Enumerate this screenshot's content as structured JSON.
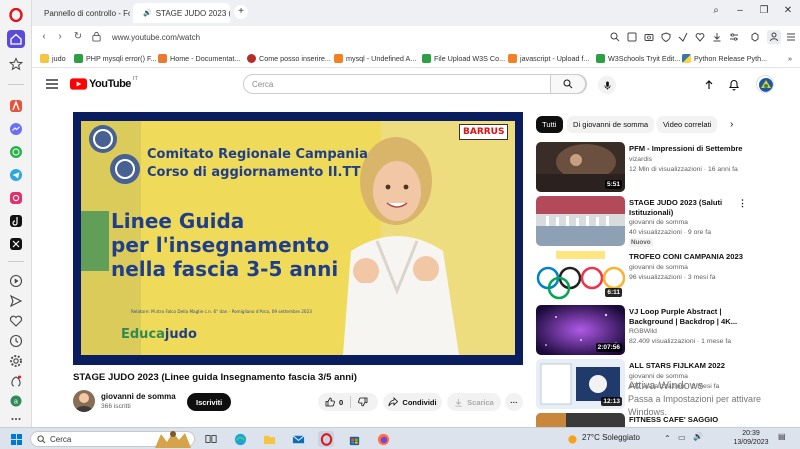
{
  "tabs": [
    {
      "label": "Pannello di controllo - Fo",
      "active": false
    },
    {
      "label": "STAGE JUDO 2023 (Li",
      "active": true
    }
  ],
  "address": {
    "url": "www.youtube.com/watch"
  },
  "bookmarks": [
    "judo",
    "PHP mysqli error() F...",
    "Home - Documentat...",
    "Come posso inserire...",
    "mysql - Undefined A...",
    "File Upload W3S Co...",
    "javascript - Upload f...",
    "W3Schools Tryit Edit...",
    "Python Release Pyth..."
  ],
  "youtube": {
    "logo": "YouTube",
    "logo_region": "IT",
    "search_placeholder": "Cerca"
  },
  "video_overlay": {
    "line1": "Comitato Regionale Campania",
    "line2": "Corso di aggiornamento II.TT",
    "line3": "Linee Guida",
    "line4": "per l'insegnamento",
    "line5": "nella fascia 3-5 anni",
    "badge": "BARRUS",
    "footer": "Relatore: M.stro Falco Della Maglie c.n. 6° dan - Pomigliano d'Arco, 09 settembre 2023",
    "brand_a": "Educa",
    "brand_b": "judo"
  },
  "video": {
    "title": "STAGE JUDO 2023 (Linee guida Insegnamento fascia 3/5 anni)",
    "channel": "giovanni de somma",
    "subscribers": "366 iscritti",
    "subscribe_label": "Iscriviti",
    "likes": "0",
    "share_label": "Condividi",
    "download_label": "Scarica",
    "more": "···"
  },
  "chips": [
    {
      "label": "Tutti",
      "active": true
    },
    {
      "label": "Di giovanni de somma",
      "active": false
    },
    {
      "label": "Video correlati",
      "active": false
    }
  ],
  "recommendations": [
    {
      "title": "PFM - Impressioni di Settembre",
      "channel": "vizardis",
      "meta": "12 Mln di visualizzazioni · 16 anni fa",
      "duration": "5:51",
      "badge": ""
    },
    {
      "title": "STAGE JUDO 2023 (Saluti Istituzionali)",
      "channel": "giovanni de somma",
      "meta": "40 visualizzazioni · 9 ore fa",
      "duration": "",
      "badge": "Nuovo"
    },
    {
      "title": "TROFEO CONI CAMPANIA 2023",
      "channel": "giovanni de somma",
      "meta": "96 visualizzazioni · 3 mesi fa",
      "duration": "6:11",
      "badge": ""
    },
    {
      "title": "VJ Loop Purple Abstract | Background | Backdrop | 4K...",
      "channel": "RGBWild",
      "meta": "82.409 visualizzazioni · 1 mese fa",
      "duration": "2:07:56",
      "badge": ""
    },
    {
      "title": "ALL STARS FIJLKAM 2022",
      "channel": "giovanni de somma",
      "meta": "199 visualizzazioni · 8 mesi fa",
      "duration": "12:13",
      "badge": ""
    },
    {
      "title": "FITNESS CAFE' SAGGIO",
      "channel": "",
      "meta": "",
      "duration": "",
      "badge": ""
    }
  ],
  "watermark": {
    "line1": "Attiva Windows",
    "line2": "Passa a Impostazioni per attivare Windows."
  },
  "taskbar": {
    "search_label": "Cerca",
    "weather": "27°C Soleggiato",
    "time": "20:39",
    "date": "13/09/2023"
  }
}
